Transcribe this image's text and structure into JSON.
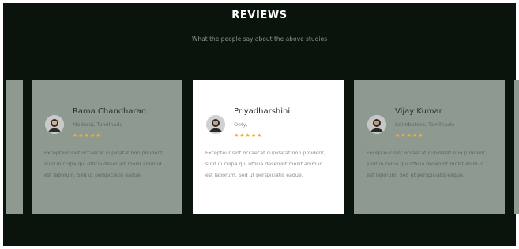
{
  "section": {
    "title": "REVIEWS",
    "subtitle": "What the people say about the above studios"
  },
  "reviews": [
    {
      "name": "Rama Chandharan",
      "location": "Madurai, Tamilnadu",
      "rating": 5,
      "stars": "★★★★★",
      "text": "Excepteur sint occaecat cupidatat non proident, sunt in culpa qui officia deserunt mollit anim id est laborum. Sed ut perspiciatis eaque."
    },
    {
      "name": "Priyadharshini",
      "location": "Ooty,",
      "rating": 5,
      "stars": "★★★★★",
      "text": "Excepteur sint occaecat cupidatat non proident, sunt in culpa qui officia deserunt mollit anim id est laborum. Sed ut perspiciatis eaque."
    },
    {
      "name": "Vijay Kumar",
      "location": "Coimbatore, Tamilnadu",
      "rating": 5,
      "stars": "★★★★★",
      "text": "Excepteur sint occaecat cupidatat non proident, sunt in culpa qui officia deserunt mollit anim id est laborum. Sed ut perspiciatis eaque."
    }
  ],
  "colors": {
    "background": "#0b140c",
    "card_inactive": "#8e9a90",
    "card_active": "#ffffff",
    "star": "#f2b01e"
  },
  "icons": {
    "avatar": "avatar-photo-icon"
  }
}
